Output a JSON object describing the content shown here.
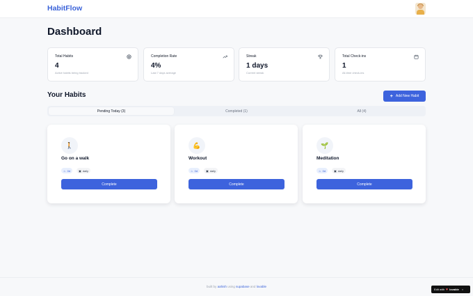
{
  "header": {
    "logo": "HabitFlow"
  },
  "dashboard": {
    "title": "Dashboard"
  },
  "stats": [
    {
      "label": "Total Habits",
      "value": "4",
      "sub": "Active habits being tracked",
      "icon": "target-icon"
    },
    {
      "label": "Completion Rate",
      "value": "4%",
      "sub": "Last 7 days average",
      "icon": "trending-up-icon"
    },
    {
      "label": "Streak",
      "value": "1 days",
      "sub": "Current streak",
      "icon": "trophy-icon"
    },
    {
      "label": "Total Check-ins",
      "value": "1",
      "sub": "All-time check-ins",
      "icon": "calendar-icon"
    }
  ],
  "habits_section": {
    "title": "Your Habits",
    "add_button": "Add New Habit"
  },
  "tabs": [
    {
      "label": "Pending Today (3)",
      "active": true
    },
    {
      "label": "Completed (1)",
      "active": false
    },
    {
      "label": "All (4)",
      "active": false
    }
  ],
  "habits": [
    {
      "emoji": "🚶",
      "name": "Go on a walk",
      "streak": "0d",
      "frequency": "daily",
      "button": "Complete"
    },
    {
      "emoji": "💪",
      "name": "Workout",
      "streak": "0d",
      "frequency": "daily",
      "button": "Complete"
    },
    {
      "emoji": "🌱",
      "name": "Meditation",
      "streak": "0d",
      "frequency": "daily",
      "button": "Complete"
    }
  ],
  "footer": {
    "built_by": "built by",
    "author": "aahish",
    "using": "using",
    "tool1": "supabase",
    "and": "and",
    "tool2": "lovable"
  },
  "edit_badge": {
    "prefix": "Edit with",
    "brand": "lovable",
    "close": "×"
  },
  "colors": {
    "accent": "#3d63dd",
    "logo": "#3b63d9",
    "background": "#f7f8fa"
  }
}
